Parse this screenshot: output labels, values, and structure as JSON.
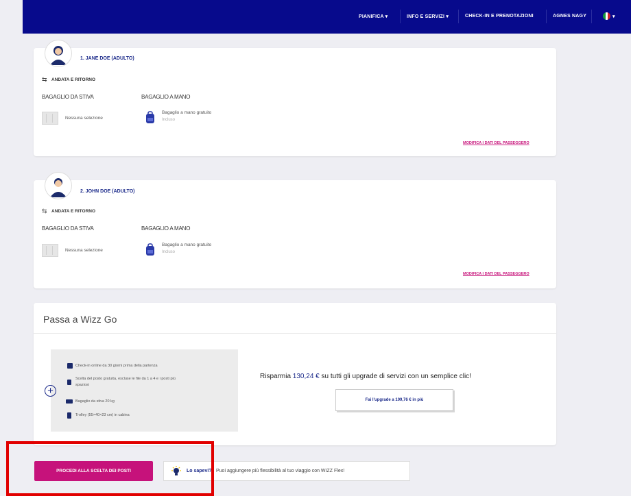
{
  "nav": {
    "plan": "PIANIFICA ▾",
    "info": "INFO E SERVIZI ▾",
    "checkin": "CHECK-IN E PRENOTAZIONI",
    "user": "AGNES NAGY",
    "lang": "▾"
  },
  "passengers": [
    {
      "name": "1. JANE DOE (ADULTO)",
      "trip": "ANDATA E RITORNO",
      "hold_head": "BAGAGLIO DA STIVA",
      "hand_head": "BAGAGLIO A MANO",
      "hold_value": "Nessuna selezione",
      "hand_value": "Bagaglio a mano gratuito",
      "hand_note": "Incluso",
      "edit": "MODIFICA I DATI DEL PASSEGGERO"
    },
    {
      "name": "2. JOHN DOE (ADULTO)",
      "trip": "ANDATA E RITORNO",
      "hold_head": "BAGAGLIO DA STIVA",
      "hand_head": "BAGAGLIO A MANO",
      "hold_value": "Nessuna selezione",
      "hand_value": "Bagaglio a mano gratuito",
      "hand_note": "Incluso",
      "edit": "MODIFICA I DATI DEL PASSEGGERO"
    }
  ],
  "wizz": {
    "title": "Passa a Wizz Go",
    "features": [
      "Check-in online da 30 giorni prima della partenza",
      "Scelta del posto gratuita, escluse le file da 1 a 4 e i posti più",
      "spaziosi",
      "Bagaglio da stiva 20 kg",
      "Trolley (55×40×23 cm) in cabina"
    ],
    "save_pre": "Risparmia ",
    "save_amount": "130,24 €",
    "save_post": " su tutti gli upgrade di servizi con un semplice clic!",
    "upgrade_button": "Fai l'upgrade a 109,76 € in più"
  },
  "cta": "PROCEDI ALLA SCELTA DEI POSTI",
  "tip": {
    "bold": "Lo sapevi?",
    "text": "Puoi aggiungere più flessibilità al tuo viaggio con WIZZ Flex!"
  }
}
